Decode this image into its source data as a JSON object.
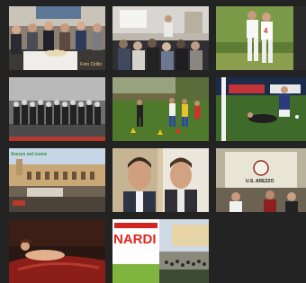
{
  "thumbnails": [
    {
      "id": "photo-ceremony",
      "caption": "Foto Cirillo"
    },
    {
      "id": "photo-conference",
      "caption": ""
    },
    {
      "id": "photo-football-players",
      "caption": ""
    },
    {
      "id": "photo-group",
      "caption": ""
    },
    {
      "id": "photo-training",
      "caption": ""
    },
    {
      "id": "photo-goalkeeper",
      "caption": ""
    },
    {
      "id": "photo-piazza",
      "caption": "Arezzo nel cuore"
    },
    {
      "id": "photo-two-men",
      "caption": ""
    },
    {
      "id": "photo-sign",
      "caption": "U.S. AREZZO"
    },
    {
      "id": "photo-painting",
      "caption": ""
    },
    {
      "id": "photo-nardini",
      "caption": "NARDI"
    },
    {
      "id": "photo-square",
      "caption": ""
    }
  ],
  "colors": {
    "background": "#232323",
    "caption": "#f1d27a",
    "accent_red": "#e0261f"
  }
}
